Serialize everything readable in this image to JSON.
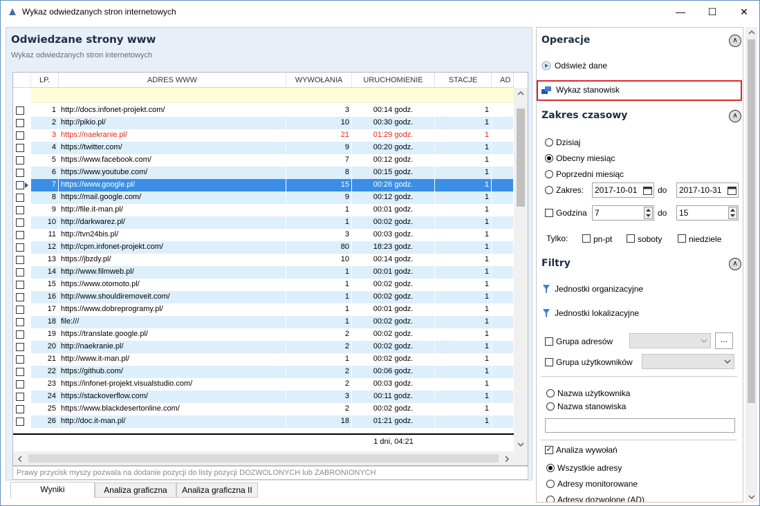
{
  "window": {
    "title": "Wykaz odwiedzanych stron internetowych",
    "minimize": "—",
    "maximize": "☐",
    "close": "✕"
  },
  "left": {
    "title": "Odwiedzane strony www",
    "subtitle": "Wykaz odwiedzanych stron internetowych",
    "columns": {
      "lp": "LP.",
      "adres": "ADRES WWW",
      "wywolania": "WYWOŁANIA",
      "uruchomienie": "URUCHOMIENIE",
      "stacje": "STACJE",
      "ad": "AD"
    },
    "rows": [
      {
        "lp": "1",
        "adres": "http://docs.infonet-projekt.com/",
        "wyw": "3",
        "uru": "00:14 godz.",
        "sta": "1"
      },
      {
        "lp": "2",
        "adres": "http://pikio.pl/",
        "wyw": "10",
        "uru": "00:30 godz.",
        "sta": "1"
      },
      {
        "lp": "3",
        "adres": "https://naekranie.pl/",
        "wyw": "21",
        "uru": "01:29 godz.",
        "sta": "1"
      },
      {
        "lp": "4",
        "adres": "https://twitter.com/",
        "wyw": "9",
        "uru": "00:20 godz.",
        "sta": "1"
      },
      {
        "lp": "5",
        "adres": "https://www.facebook.com/",
        "wyw": "7",
        "uru": "00:12 godz.",
        "sta": "1"
      },
      {
        "lp": "6",
        "adres": "https://www.youtube.com/",
        "wyw": "8",
        "uru": "00:15 godz.",
        "sta": "1"
      },
      {
        "lp": "7",
        "adres": "https://www.google.pl/",
        "wyw": "15",
        "uru": "00:26 godz.",
        "sta": "1"
      },
      {
        "lp": "8",
        "adres": "https://mail.google.com/",
        "wyw": "9",
        "uru": "00:12 godz.",
        "sta": "1"
      },
      {
        "lp": "9",
        "adres": "http://file.it-man.pl/",
        "wyw": "1",
        "uru": "00:01 godz.",
        "sta": "1"
      },
      {
        "lp": "10",
        "adres": "http://darkwarez.pl/",
        "wyw": "1",
        "uru": "00:02 godz.",
        "sta": "1"
      },
      {
        "lp": "11",
        "adres": "http://tvn24bis.pl/",
        "wyw": "3",
        "uru": "00:03 godz.",
        "sta": "1"
      },
      {
        "lp": "12",
        "adres": "http://cpm.infonet-projekt.com/",
        "wyw": "80",
        "uru": "18:23 godz.",
        "sta": "1"
      },
      {
        "lp": "13",
        "adres": "https://jbzdy.pl/",
        "wyw": "10",
        "uru": "00:14 godz.",
        "sta": "1"
      },
      {
        "lp": "14",
        "adres": "http://www.filmweb.pl/",
        "wyw": "1",
        "uru": "00:01 godz.",
        "sta": "1"
      },
      {
        "lp": "15",
        "adres": "https://www.otomoto.pl/",
        "wyw": "1",
        "uru": "00:02 godz.",
        "sta": "1"
      },
      {
        "lp": "16",
        "adres": "http://www.shouldiremoveit.com/",
        "wyw": "1",
        "uru": "00:02 godz.",
        "sta": "1"
      },
      {
        "lp": "17",
        "adres": "https://www.dobreprogramy.pl/",
        "wyw": "1",
        "uru": "00:01 godz.",
        "sta": "1"
      },
      {
        "lp": "18",
        "adres": "file:///",
        "wyw": "1",
        "uru": "00:02 godz.",
        "sta": "1"
      },
      {
        "lp": "19",
        "adres": "https://translate.google.pl/",
        "wyw": "2",
        "uru": "00:02 godz.",
        "sta": "1"
      },
      {
        "lp": "20",
        "adres": "http://naekranie.pl/",
        "wyw": "2",
        "uru": "00:02 godz.",
        "sta": "1"
      },
      {
        "lp": "21",
        "adres": "http://www.it-man.pl/",
        "wyw": "1",
        "uru": "00:02 godz.",
        "sta": "1"
      },
      {
        "lp": "22",
        "adres": "https://github.com/",
        "wyw": "2",
        "uru": "00:06 godz.",
        "sta": "1"
      },
      {
        "lp": "23",
        "adres": "https://infonet-projekt.visualstudio.com/",
        "wyw": "2",
        "uru": "00:03 godz.",
        "sta": "1"
      },
      {
        "lp": "24",
        "adres": "https://stackoverflow.com/",
        "wyw": "3",
        "uru": "00:11 godz.",
        "sta": "1"
      },
      {
        "lp": "25",
        "adres": "https://www.blackdesertonline.com/",
        "wyw": "2",
        "uru": "00:02 godz.",
        "sta": "1"
      },
      {
        "lp": "26",
        "adres": "http://doc.it-man.pl/",
        "wyw": "18",
        "uru": "01:21 godz.",
        "sta": "1"
      }
    ],
    "summary": "1 dni, 04:21",
    "hint": "Prawy przycisk myszy pozwala na dodanie pozycji do listy pozycji DOZWOLONYCH lub ZABRONIONYCH",
    "tabs": [
      "Wyniki",
      "Analiza graficzna",
      "Analiza graficzna II"
    ],
    "colors": {
      "highlight_row": "#3a8ee6",
      "alert_text": "#e8261c",
      "alt_row": "#dceffb"
    }
  },
  "right": {
    "operacje": {
      "title": "Operacje",
      "items": [
        "Odśwież dane",
        "Wykaz stanowisk"
      ]
    },
    "zakres": {
      "title": "Zakres czasowy",
      "options": [
        "Dzisiaj",
        "Obecny miesiąc",
        "Poprzedni miesiąc",
        "Zakres:"
      ],
      "date_from": "2017-10-01",
      "date_to": "2017-10-31",
      "do": "do",
      "godzina_label": "Godzina",
      "hour_from": "7",
      "hour_to": "15",
      "tylko": "Tylko:",
      "pnpt": "pn-pt",
      "soboty": "soboty",
      "niedziele": "niedziele"
    },
    "filtry": {
      "title": "Filtry",
      "jednostki_org": "Jednostki organizacyjne",
      "jednostki_lok": "Jednostki lokalizacyjne",
      "grupa_adresow": "Grupa adresów",
      "grupa_uzytkownikow": "Grupa użytkowników",
      "browse": "...",
      "nazwa_uzytkownika": "Nazwa użytkownika",
      "nazwa_stanowiska": "Nazwa stanowiska",
      "analiza": "Analiza wywołań",
      "wszystkie": "Wszystkie adresy",
      "monitorowane": "Adresy monitorowane",
      "dozwolone": "Adresy dozwolone (AD)"
    }
  }
}
